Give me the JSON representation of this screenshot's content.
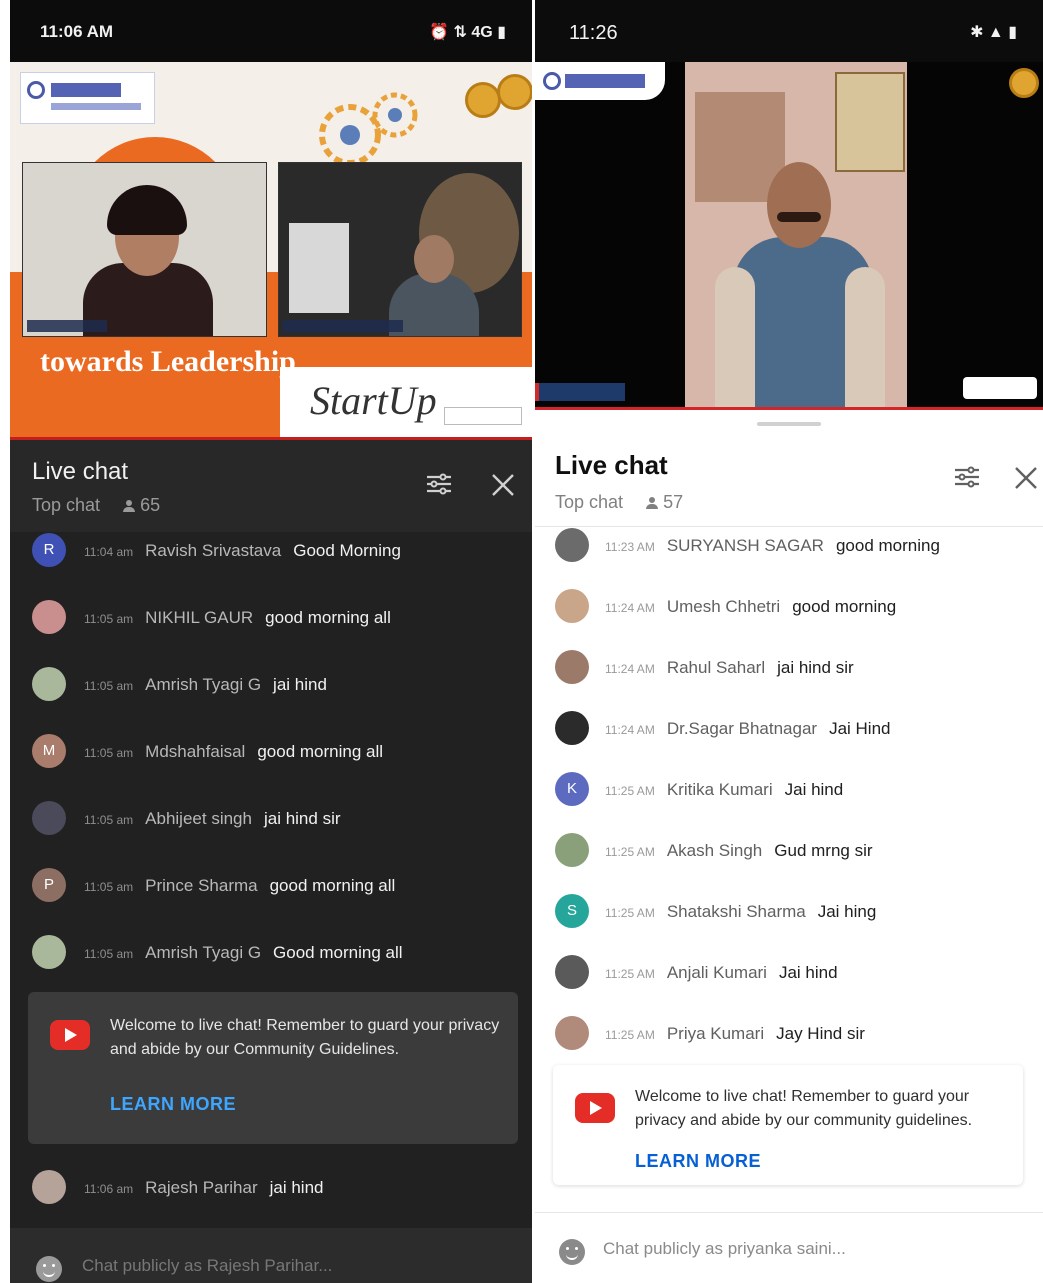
{
  "left": {
    "status_time": "11:06 AM",
    "status_icons": "⏰ ⇅ 4G ▮",
    "video": {
      "tagline": "towards Leadership",
      "startup_text": "StartUp"
    },
    "chat_title": "Live chat",
    "chat_mode": "Top chat",
    "viewer_count": "65",
    "messages": [
      {
        "avatar_letter": "R",
        "avatar_color": "#3f51b5",
        "time": "11:04 am",
        "author": "Ravish Srivastava",
        "text": "Good Morning"
      },
      {
        "avatar_letter": "",
        "avatar_color": "#c98f8f",
        "time": "11:05 am",
        "author": "NIKHIL GAUR",
        "text": "good morning all"
      },
      {
        "avatar_letter": "",
        "avatar_color": "#a9b89a",
        "time": "11:05 am",
        "author": "Amrish Tyagi G",
        "text": "jai hind"
      },
      {
        "avatar_letter": "M",
        "avatar_color": "#a97c6c",
        "time": "11:05 am",
        "author": "Mdshahfaisal",
        "text": "good morning all"
      },
      {
        "avatar_letter": "",
        "avatar_color": "#4a4a5a",
        "time": "11:05 am",
        "author": "Abhijeet singh",
        "text": "jai hind sir"
      },
      {
        "avatar_letter": "P",
        "avatar_color": "#8d6e63",
        "time": "11:05 am",
        "author": "Prince Sharma",
        "text": "good morning all"
      },
      {
        "avatar_letter": "",
        "avatar_color": "#a9b89a",
        "time": "11:05 am",
        "author": "Amrish Tyagi G",
        "text": "Good morning all"
      }
    ],
    "welcome_text": "Welcome to live chat! Remember to guard your privacy and abide by our Community Guidelines.",
    "learn_more": "LEARN MORE",
    "last_message": {
      "avatar_letter": "",
      "avatar_color": "#b5a39a",
      "time": "11:06 am",
      "author": "Rajesh Parihar",
      "text": "jai hind"
    },
    "input_placeholder": "Chat publicly as Rajesh Parihar..."
  },
  "right": {
    "status_time": "11:26",
    "status_icons": "✱ ▲ ▮",
    "chat_title": "Live chat",
    "chat_mode": "Top chat",
    "viewer_count": "57",
    "messages": [
      {
        "avatar_letter": "",
        "avatar_color": "#6b6b6b",
        "time": "11:23 AM",
        "author": "SURYANSH SAGAR",
        "text": "good morning"
      },
      {
        "avatar_letter": "",
        "avatar_color": "#c9a58a",
        "time": "11:24 AM",
        "author": "Umesh Chhetri",
        "text": "good morning"
      },
      {
        "avatar_letter": "",
        "avatar_color": "#9c7a6a",
        "time": "11:24 AM",
        "author": "Rahul Saharl",
        "text": "jai hind sir"
      },
      {
        "avatar_letter": "",
        "avatar_color": "#2b2b2b",
        "time": "11:24 AM",
        "author": "Dr.Sagar Bhatnagar",
        "text": "Jai Hind"
      },
      {
        "avatar_letter": "K",
        "avatar_color": "#5c6bc0",
        "time": "11:25 AM",
        "author": "Kritika Kumari",
        "text": "Jai hind"
      },
      {
        "avatar_letter": "",
        "avatar_color": "#8aa07a",
        "time": "11:25 AM",
        "author": "Akash Singh",
        "text": "Gud mrng sir"
      },
      {
        "avatar_letter": "S",
        "avatar_color": "#26a69a",
        "time": "11:25 AM",
        "author": "Shatakshi Sharma",
        "text": "Jai hing"
      },
      {
        "avatar_letter": "",
        "avatar_color": "#5a5a5a",
        "time": "11:25 AM",
        "author": "Anjali Kumari",
        "text": "Jai hind"
      },
      {
        "avatar_letter": "",
        "avatar_color": "#b08a7a",
        "time": "11:25 AM",
        "author": "Priya Kumari",
        "text": "Jay Hind sir"
      }
    ],
    "welcome_text": "Welcome to live chat! Remember to guard your privacy and abide by our community guidelines.",
    "learn_more": "LEARN MORE",
    "input_placeholder": "Chat publicly as priyanka saini..."
  }
}
